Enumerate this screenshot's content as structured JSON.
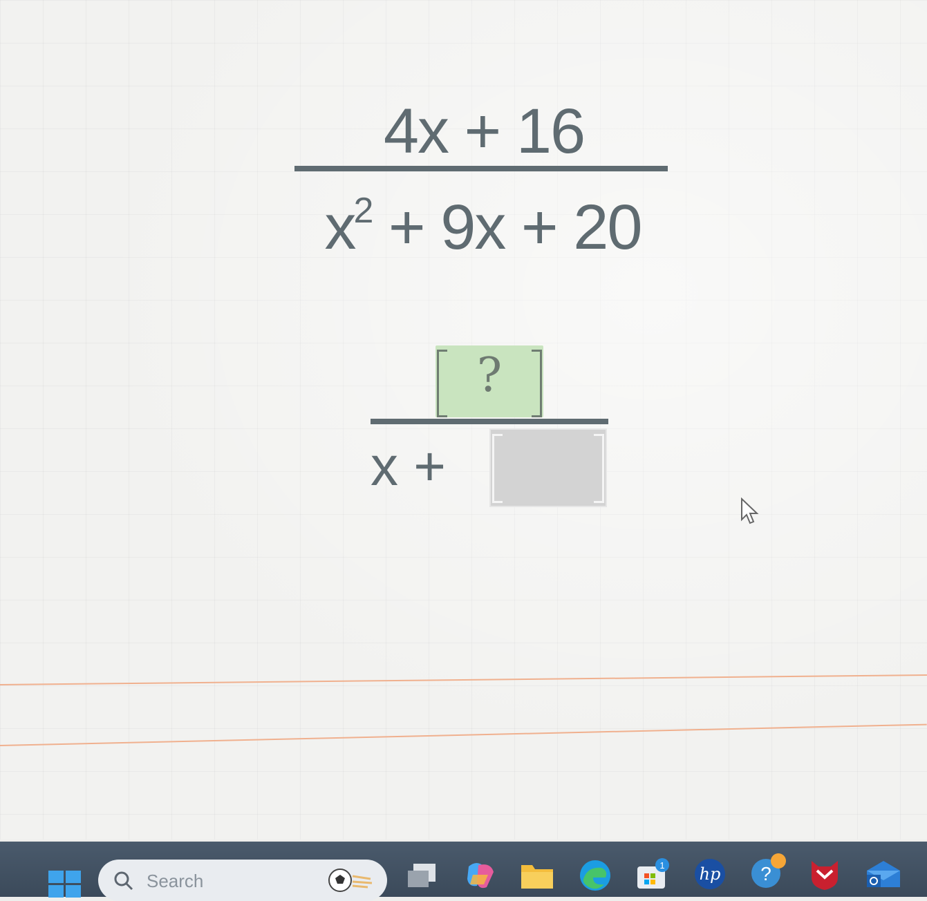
{
  "problem": {
    "numerator": "4x + 16",
    "denominator_base": "x",
    "denominator_exponent": "2",
    "denominator_rest": " + 9x + 20"
  },
  "answer": {
    "numerator_placeholder": "?",
    "denominator_prefix": "x + "
  },
  "taskbar": {
    "search_label": "Search",
    "copilot_badge_count": "1",
    "icons": [
      "windows-start-icon",
      "search-icon",
      "task-view-icon",
      "copilot-icon",
      "file-explorer-icon",
      "edge-icon",
      "store-icon",
      "hp-icon",
      "help-icon",
      "mcafee-icon",
      "outlook-icon"
    ]
  },
  "colors": {
    "math_text": "#5f6b71",
    "answer_box_fill": "#c9e4bf",
    "empty_box_fill": "#d3d3d3",
    "taskbar": "#44546a"
  }
}
